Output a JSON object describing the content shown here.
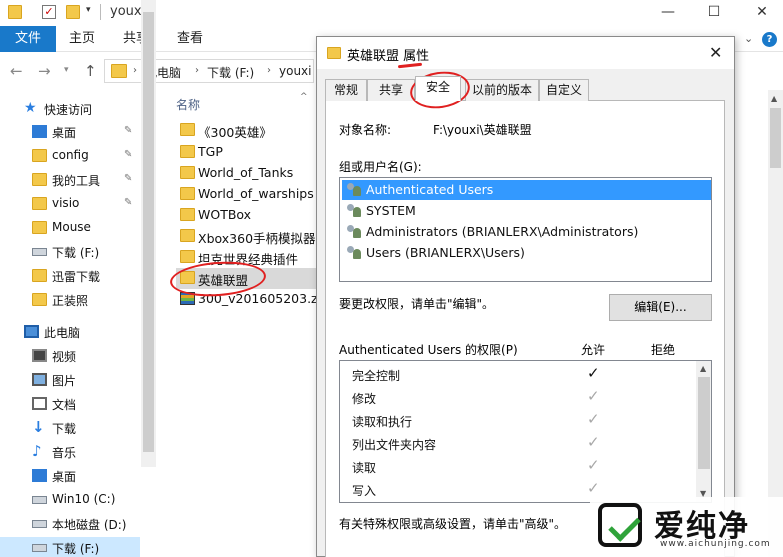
{
  "window": {
    "title": "youxi",
    "controls": {
      "min": "—",
      "max": "☐",
      "close": "✕"
    }
  },
  "ribbon": {
    "tabs": [
      "文件",
      "主页",
      "共享",
      "查看"
    ],
    "help": "?",
    "chevron": "⌄"
  },
  "address": {
    "crumbs": [
      "此电脑",
      "下载 (F:)",
      "youxi"
    ],
    "separator": "›"
  },
  "nav_pane": {
    "items": [
      {
        "label": "快速访问",
        "icon": "star-icon"
      },
      {
        "label": "桌面",
        "icon": "desktop-icon",
        "pinned": true
      },
      {
        "label": "config",
        "icon": "folder-icon",
        "pinned": true
      },
      {
        "label": "我的工具",
        "icon": "folder-icon",
        "pinned": true
      },
      {
        "label": "visio",
        "icon": "folder-icon",
        "pinned": true
      },
      {
        "label": "Mouse",
        "icon": "folder-icon"
      },
      {
        "label": "下载 (F:)",
        "icon": "drive-icon"
      },
      {
        "label": "迅雷下载",
        "icon": "folder-icon"
      },
      {
        "label": "正装照",
        "icon": "folder-icon"
      },
      {
        "label": "此电脑",
        "icon": "computer-icon"
      },
      {
        "label": "视频",
        "icon": "video-icon"
      },
      {
        "label": "图片",
        "icon": "pictures-icon"
      },
      {
        "label": "文档",
        "icon": "documents-icon"
      },
      {
        "label": "下载",
        "icon": "download-icon"
      },
      {
        "label": "音乐",
        "icon": "music-icon"
      },
      {
        "label": "桌面",
        "icon": "desktop-icon"
      },
      {
        "label": "Win10 (C:)",
        "icon": "drive-icon"
      },
      {
        "label": "本地磁盘 (D:)",
        "icon": "drive-icon"
      },
      {
        "label": "下载 (F:)",
        "icon": "drive-icon"
      }
    ],
    "pin_glyph": "📌"
  },
  "file_pane": {
    "column_header": "名称",
    "files": [
      {
        "name": "《300英雄》",
        "type": "folder"
      },
      {
        "name": "TGP",
        "type": "folder"
      },
      {
        "name": "World_of_Tanks",
        "type": "folder"
      },
      {
        "name": "World_of_warships",
        "type": "folder"
      },
      {
        "name": "WOTBox",
        "type": "folder"
      },
      {
        "name": "Xbox360手柄模拟器",
        "type": "folder"
      },
      {
        "name": "坦克世界经典插件",
        "type": "folder"
      },
      {
        "name": "英雄联盟",
        "type": "folder",
        "selected": true
      },
      {
        "name": "300_v201605203.zip",
        "type": "zip"
      }
    ]
  },
  "dialog": {
    "title": "英雄联盟 属性",
    "close": "✕",
    "tabs": [
      "常规",
      "共享",
      "安全",
      "以前的版本",
      "自定义"
    ],
    "active_tab": "安全",
    "object_label": "对象名称:",
    "object_value": "F:\\youxi\\英雄联盟",
    "group_label": "组或用户名(G):",
    "users": [
      {
        "name": "Authenticated Users",
        "selected": true
      },
      {
        "name": "SYSTEM"
      },
      {
        "name": "Administrators (BRIANLERX\\Administrators)"
      },
      {
        "name": "Users (BRIANLERX\\Users)"
      }
    ],
    "edit_hint": "要更改权限，请单击\"编辑\"。",
    "edit_button": "编辑(E)...",
    "perm_title": "Authenticated Users 的权限(P)",
    "allow_header": "允许",
    "deny_header": "拒绝",
    "permissions": [
      {
        "name": "完全控制",
        "allow": "on"
      },
      {
        "name": "修改",
        "allow": "grey"
      },
      {
        "name": "读取和执行",
        "allow": "grey"
      },
      {
        "name": "列出文件夹内容",
        "allow": "grey"
      },
      {
        "name": "读取",
        "allow": "grey"
      },
      {
        "name": "写入",
        "allow": "grey"
      }
    ],
    "check_glyph": "✓",
    "advanced_hint": "有关特殊权限或高级设置，请单击\"高级\"。"
  },
  "watermark": {
    "text": "爱纯净",
    "url": "www.aichunjing.com"
  },
  "colors": {
    "accent": "#1979ca",
    "selection": "#3399ff",
    "annotation": "#e02020"
  }
}
